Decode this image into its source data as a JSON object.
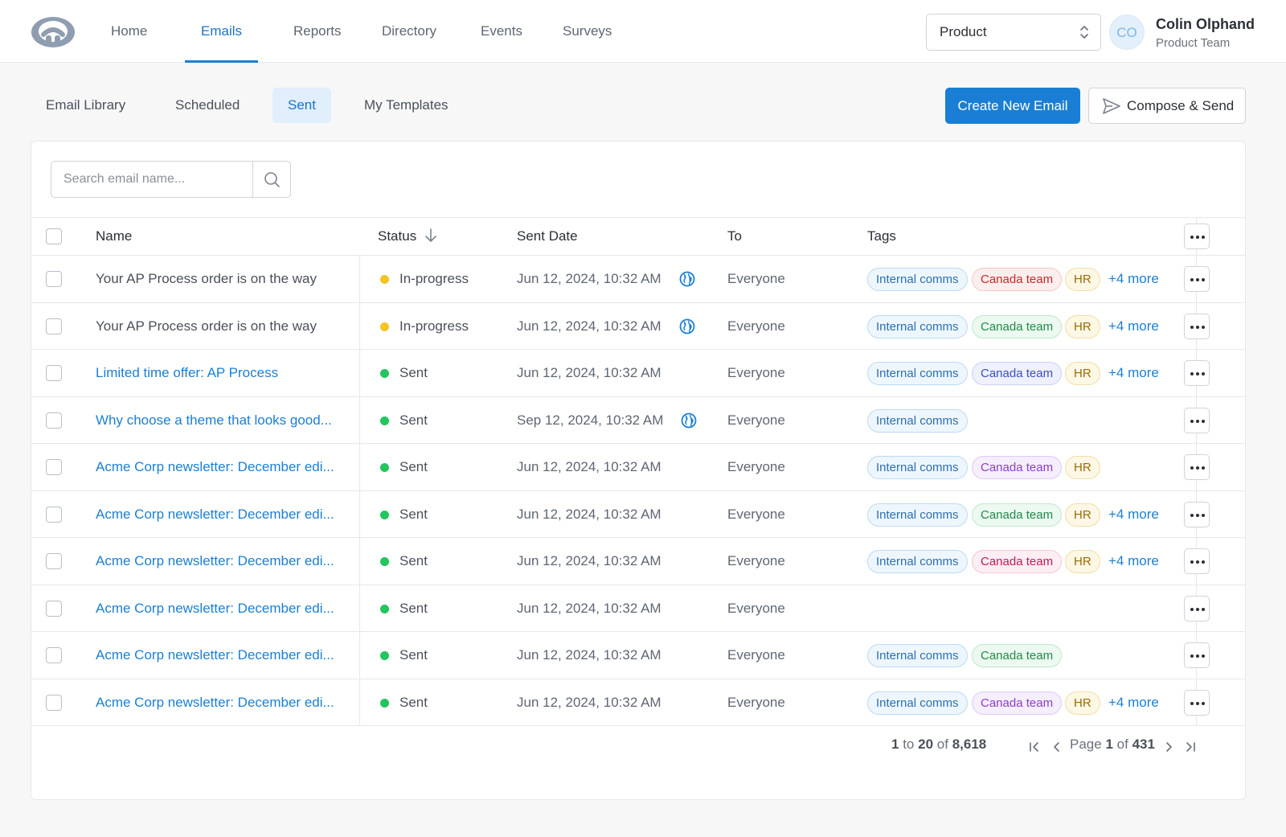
{
  "nav": {
    "items": [
      "Home",
      "Emails",
      "Reports",
      "Directory",
      "Events",
      "Surveys"
    ],
    "active": "Emails"
  },
  "team_select": {
    "value": "Product"
  },
  "user": {
    "initials": "CO",
    "name": "Colin Olphand",
    "team": "Product Team"
  },
  "subtabs": {
    "items": [
      "Email Library",
      "Scheduled",
      "Sent",
      "My Templates"
    ],
    "active": "Sent"
  },
  "actions": {
    "create": "Create New Email",
    "compose": "Compose & Send"
  },
  "search": {
    "placeholder": "Search email name...",
    "value": ""
  },
  "table": {
    "columns": {
      "name": "Name",
      "status": "Status",
      "sent_date": "Sent Date",
      "to": "To",
      "tags": "Tags"
    },
    "rows": [
      {
        "name": "Your AP Process order is on the way",
        "linked": false,
        "status": "In-progress",
        "status_color": "#f5c324",
        "date": "Jun 12, 2024, 10:32 AM",
        "globe": true,
        "to": "Everyone",
        "tags": [
          {
            "label": "Internal comms",
            "style": "internal"
          },
          {
            "label": "Canada team",
            "style": "red"
          },
          {
            "label": "HR",
            "style": "hr"
          }
        ],
        "more": "+4 more"
      },
      {
        "name": "Your AP Process order is on the way",
        "linked": false,
        "status": "In-progress",
        "status_color": "#f5c324",
        "date": "Jun 12, 2024, 10:32 AM",
        "globe": true,
        "to": "Everyone",
        "tags": [
          {
            "label": "Internal comms",
            "style": "internal"
          },
          {
            "label": "Canada team",
            "style": "green"
          },
          {
            "label": "HR",
            "style": "hr"
          }
        ],
        "more": "+4 more"
      },
      {
        "name": "Limited time offer: AP Process",
        "linked": true,
        "status": "Sent",
        "status_color": "#22c55e",
        "date": "Jun 12, 2024, 10:32 AM",
        "globe": false,
        "to": "Everyone",
        "tags": [
          {
            "label": "Internal comms",
            "style": "internal"
          },
          {
            "label": "Canada team",
            "style": "indigo"
          },
          {
            "label": "HR",
            "style": "hr"
          }
        ],
        "more": "+4 more"
      },
      {
        "name": "Why choose a theme that looks good...",
        "linked": true,
        "status": "Sent",
        "status_color": "#22c55e",
        "date": "Sep 12, 2024, 10:32 AM",
        "globe": true,
        "to": "Everyone",
        "tags": [
          {
            "label": "Internal comms",
            "style": "internal"
          }
        ],
        "more": ""
      },
      {
        "name": "Acme Corp newsletter: December edi...",
        "linked": true,
        "status": "Sent",
        "status_color": "#22c55e",
        "date": "Jun 12, 2024, 10:32 AM",
        "globe": false,
        "to": "Everyone",
        "tags": [
          {
            "label": "Internal comms",
            "style": "internal"
          },
          {
            "label": "Canada team",
            "style": "purple"
          },
          {
            "label": "HR",
            "style": "hr"
          }
        ],
        "more": ""
      },
      {
        "name": "Acme Corp newsletter: December edi...",
        "linked": true,
        "status": "Sent",
        "status_color": "#22c55e",
        "date": "Jun 12, 2024, 10:32 AM",
        "globe": false,
        "to": "Everyone",
        "tags": [
          {
            "label": "Internal comms",
            "style": "internal"
          },
          {
            "label": "Canada team",
            "style": "green"
          },
          {
            "label": "HR",
            "style": "hr"
          }
        ],
        "more": "+4 more"
      },
      {
        "name": "Acme Corp newsletter: December edi...",
        "linked": true,
        "status": "Sent",
        "status_color": "#22c55e",
        "date": "Jun 12, 2024, 10:32 AM",
        "globe": false,
        "to": "Everyone",
        "tags": [
          {
            "label": "Internal comms",
            "style": "internal"
          },
          {
            "label": "Canada team",
            "style": "pink"
          },
          {
            "label": "HR",
            "style": "hr"
          }
        ],
        "more": "+4 more"
      },
      {
        "name": "Acme Corp newsletter: December edi...",
        "linked": true,
        "status": "Sent",
        "status_color": "#22c55e",
        "date": "Jun 12, 2024, 10:32 AM",
        "globe": false,
        "to": "Everyone",
        "tags": [],
        "more": ""
      },
      {
        "name": "Acme Corp newsletter: December edi...",
        "linked": true,
        "status": "Sent",
        "status_color": "#22c55e",
        "date": "Jun 12, 2024, 10:32 AM",
        "globe": false,
        "to": "Everyone",
        "tags": [
          {
            "label": "Internal comms",
            "style": "internal"
          },
          {
            "label": "Canada team",
            "style": "green"
          }
        ],
        "more": ""
      },
      {
        "name": "Acme Corp newsletter: December edi...",
        "linked": true,
        "status": "Sent",
        "status_color": "#22c55e",
        "date": "Jun 12, 2024, 10:32 AM",
        "globe": false,
        "to": "Everyone",
        "tags": [
          {
            "label": "Internal comms",
            "style": "internal"
          },
          {
            "label": "Canada team",
            "style": "purple"
          },
          {
            "label": "HR",
            "style": "hr"
          }
        ],
        "more": "+4 more"
      }
    ]
  },
  "pagination": {
    "range_start": "1",
    "range_word": "to",
    "range_end": "20",
    "of_word": "of",
    "total": "8,618",
    "page_word": "Page",
    "page": "1",
    "pages": "431"
  },
  "colors": {
    "accent": "#1a7fd4",
    "in_progress": "#f5c324",
    "sent": "#22c55e"
  },
  "icons": [
    "logo-icon",
    "chevron-updown-icon",
    "send-icon",
    "search-icon",
    "sort-down-icon",
    "globe-icon",
    "more-dots-icon",
    "first-page-icon",
    "prev-page-icon",
    "next-page-icon",
    "last-page-icon"
  ]
}
